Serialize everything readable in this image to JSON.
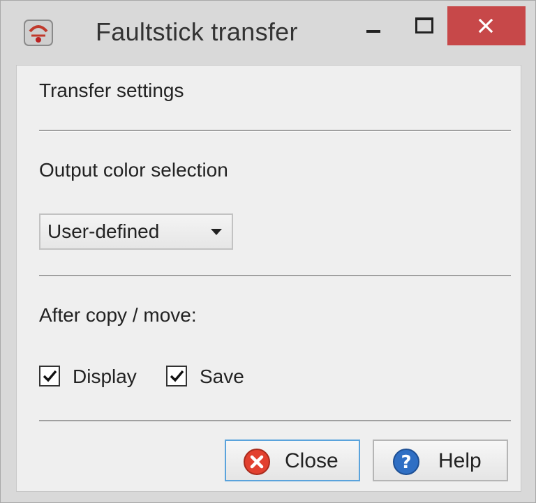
{
  "window": {
    "title": "Faultstick transfer",
    "close_color": "#c74849"
  },
  "sections": {
    "transfer_settings_label": "Transfer settings",
    "output_color_label": "Output color selection",
    "after_copy_label": "After copy / move:"
  },
  "output_color_select": {
    "selected": "User-defined"
  },
  "checkboxes": [
    {
      "label": "Display",
      "checked": true
    },
    {
      "label": "Save",
      "checked": true
    }
  ],
  "buttons": {
    "close_label": "Close",
    "help_label": "Help"
  },
  "icons": {
    "app": "faultstick-app-icon",
    "close_button": "red-x-circle-icon",
    "help_button": "blue-question-circle-icon"
  }
}
